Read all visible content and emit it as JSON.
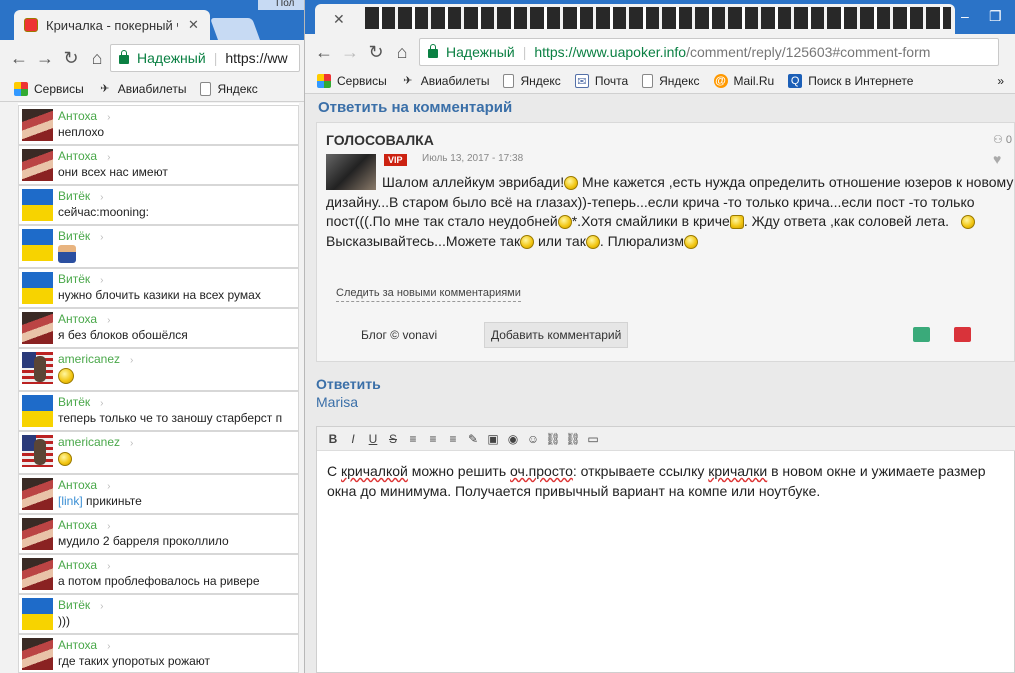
{
  "left_window": {
    "tab_title": "Кричалка - покерный ча",
    "tab2_label": "Пол",
    "address": {
      "secure_label": "Надежный",
      "url": "https://ww"
    },
    "bookmarks": [
      "Сервисы",
      "Авиабилеты",
      "Яндекс"
    ],
    "messages": [
      {
        "nick": "Антоха",
        "avatar": "antoha",
        "text": "неплохо"
      },
      {
        "nick": "Антоха",
        "avatar": "antoha",
        "text": "они всех нас имеют"
      },
      {
        "nick": "Витёк",
        "avatar": "vitek",
        "text": "сейчас:mooning:"
      },
      {
        "nick": "Витёк",
        "avatar": "vitek",
        "text": ""
      },
      {
        "nick": "Витёк",
        "avatar": "vitek",
        "text": "нужно блочить казики на всех румах"
      },
      {
        "nick": "Антоха",
        "avatar": "antoha",
        "text": "я без блоков обошёлся"
      },
      {
        "nick": "americanez",
        "avatar": "us",
        "text": ""
      },
      {
        "nick": "Витёк",
        "avatar": "vitek",
        "text": "теперь только че то заношу старберст п"
      },
      {
        "nick": "americanez",
        "avatar": "us",
        "text": ""
      },
      {
        "nick": "Антоха",
        "avatar": "antoha",
        "text": "прикиньте",
        "link": "[link]"
      },
      {
        "nick": "Антоха",
        "avatar": "antoha",
        "text": "мудило 2 барреля проколлило"
      },
      {
        "nick": "Антоха",
        "avatar": "antoha",
        "text": "а потом проблефовалось на ривере"
      },
      {
        "nick": "Витёк",
        "avatar": "vitek",
        "text": ")))"
      },
      {
        "nick": "Антоха",
        "avatar": "antoha",
        "text": "где таких упоротых рожают"
      }
    ]
  },
  "right_window": {
    "address": {
      "secure_label": "Надежный",
      "url_main": "https://www.uapoker.info",
      "url_rest": "/comment/reply/125603#comment-form"
    },
    "bookmarks": [
      "Сервисы",
      "Авиабилеты",
      "Яндекс",
      "Почта",
      "Яндекс",
      "Mail.Ru",
      "Поиск в Интернете"
    ],
    "page": {
      "heading": "Ответить на комментарий",
      "comment": {
        "title": "ГОЛОСОВАЛКА",
        "badge": "VIP",
        "date": "Июль 13, 2017 - 17:38",
        "body_1": "Шалом аллейкум эврибади!",
        "body_2": " Мне кажется ,есть нужда определить отношение юзеров к новому дизайну...В старом было всё на глазах))-теперь...если крича -то только крича...если пост -то только пост(((.По мне так стало неудобней",
        "body_3": "*.Хотя смайлики в криче",
        "body_4": ". Жду ответа ,как соловей лета.",
        "body_5": " Высказывайтесь...Можете так",
        "body_6": " или так",
        "body_7": ". Плюрализм",
        "follow": "Следить за новыми комментариями",
        "blog": "Блог © vonavi",
        "add_button": "Добавить комментарий",
        "side_count": "0"
      },
      "reply_label": "Ответить",
      "reply_to": "Marisa",
      "editor": {
        "toolbar": [
          "B",
          "I",
          "U",
          "S"
        ],
        "t1": "С ",
        "t2": "кричалкой",
        "t3": " можно решить ",
        "t4": "оч.просто",
        "t5": ": открываете ссылку ",
        "t6": "кричалки",
        "t7": " в новом окне и ужимаете размер окна до минимума. Получается привычный вариант на компе или ноутбуке."
      }
    }
  }
}
